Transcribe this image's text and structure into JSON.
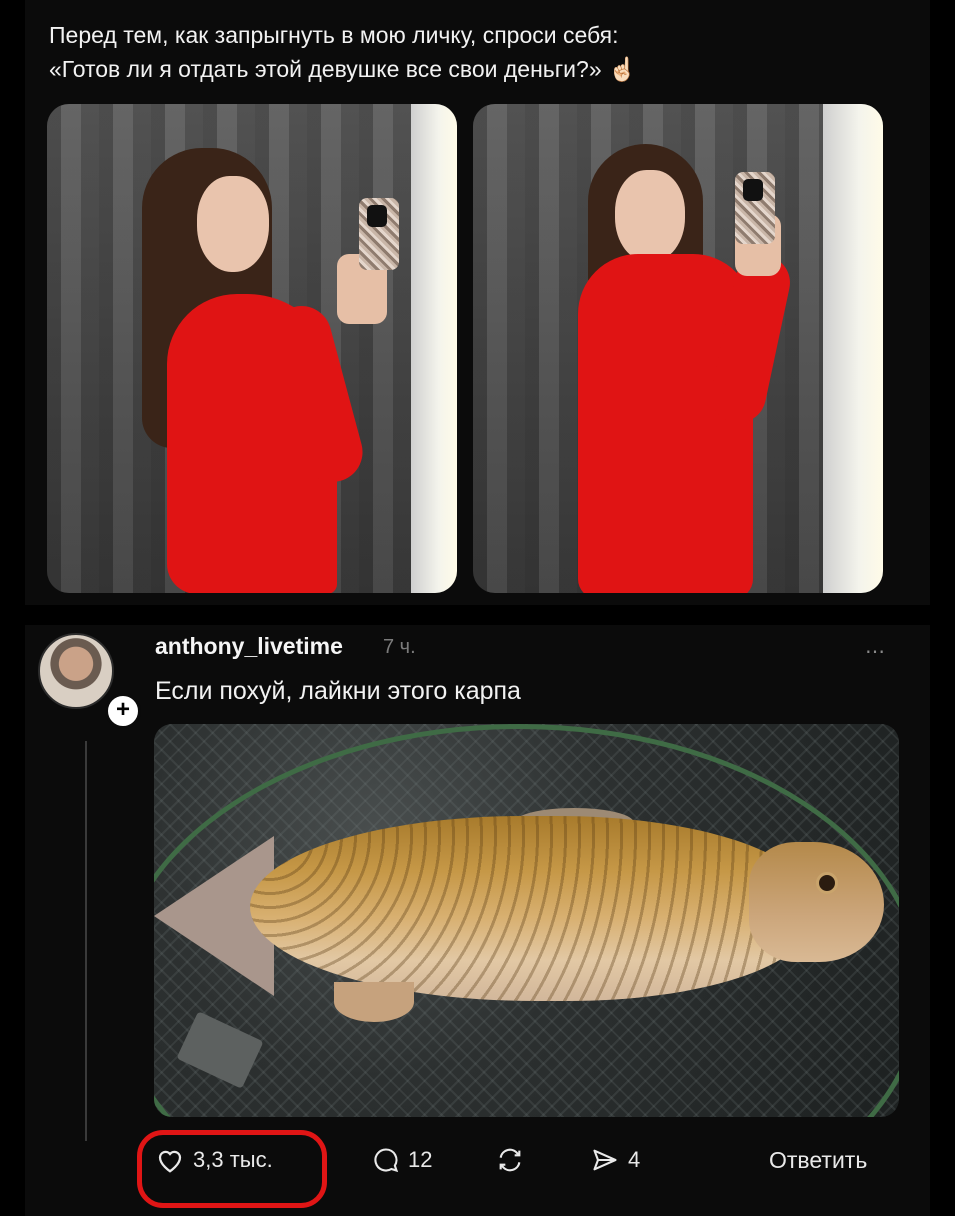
{
  "top_post": {
    "caption_line1": "Перед тем, как запрыгнуть в мою личку, спроси себя:",
    "caption_line2": "«Готов ли я отдать этой девушке все свои деньги?» ☝🏻"
  },
  "comment": {
    "username": "anthony_livetime",
    "timestamp": "7 ч.",
    "text": "Если похуй, лайкни этого карпа",
    "more_icon": "⋯",
    "follow_icon": "+",
    "actions": {
      "likes": "3,3 тыс.",
      "comments": "12",
      "shares": "4",
      "reply_label": "Ответить"
    },
    "highlight_color": "#e01515"
  }
}
